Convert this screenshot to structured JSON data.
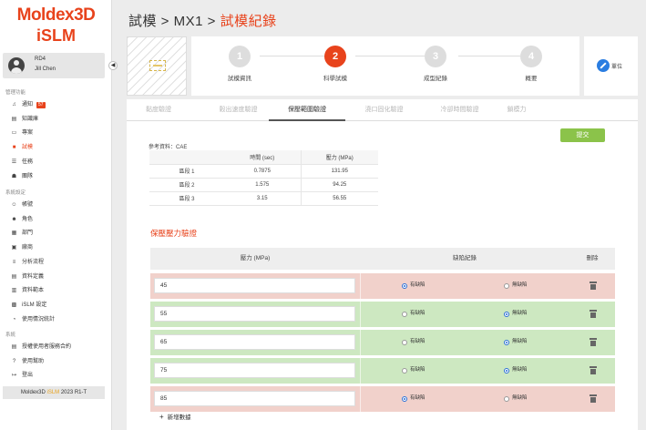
{
  "brand": {
    "line1": "Moldex3D",
    "line2": "iSLM"
  },
  "user": {
    "org": "RD4",
    "name": "Jill Chen"
  },
  "sidebar": {
    "section_manage": "管理功能",
    "manage_items": [
      {
        "label": "通知",
        "icon": "bell-icon",
        "badge": "57"
      },
      {
        "label": "知識庫",
        "icon": "book-icon"
      },
      {
        "label": "專案",
        "icon": "folder-icon"
      },
      {
        "label": "試模",
        "icon": "trial-icon"
      },
      {
        "label": "任務",
        "icon": "task-icon"
      },
      {
        "label": "團隊",
        "icon": "team-icon"
      }
    ],
    "section_system_settings": "系統設定",
    "settings_items": [
      {
        "label": "帳號",
        "icon": "account-icon"
      },
      {
        "label": "角色",
        "icon": "role-icon"
      },
      {
        "label": "部門",
        "icon": "department-icon"
      },
      {
        "label": "廠商",
        "icon": "vendor-icon"
      },
      {
        "label": "分析流程",
        "icon": "analysis-flow-icon"
      },
      {
        "label": "資料定義",
        "icon": "data-definition-icon"
      },
      {
        "label": "資料範本",
        "icon": "data-template-icon"
      },
      {
        "label": "iSLM 設定",
        "icon": "settings-icon"
      },
      {
        "label": "使用情況統計",
        "icon": "usage-stats-icon"
      }
    ],
    "section_system": "系統",
    "system_items": [
      {
        "label": "授權使用者服務合約",
        "icon": "license-icon"
      },
      {
        "label": "使用幫助",
        "icon": "help-icon"
      },
      {
        "label": "登出",
        "icon": "logout-icon"
      }
    ],
    "version_prefix": "Moldex3D ",
    "version_accent": "iSLM",
    "version_suffix": " 2023 R1-T"
  },
  "header": {
    "crumb1": "試模",
    "sep1": " > ",
    "crumb2": "MX1",
    "sep2": " > ",
    "current": "試模紀錄"
  },
  "steps": [
    {
      "num": "1",
      "label": "試模資訊"
    },
    {
      "num": "2",
      "label": "科學試模"
    },
    {
      "num": "3",
      "label": "成型紀錄"
    },
    {
      "num": "4",
      "label": "概要"
    }
  ],
  "settings_label": "單位",
  "tabs": [
    "黏度驗證",
    "穀出速度驗證",
    "保壓範圍驗證",
    "澆口固化驗證",
    "冷卻時間驗證",
    "鎖模力"
  ],
  "submit_label": "提交",
  "reference": {
    "label": "參考資料：CAE",
    "headers": [
      "",
      "時間 (sec)",
      "壓力 (MPa)"
    ],
    "rows": [
      [
        "區段 1",
        "0.7875",
        "131.95"
      ],
      [
        "區段 2",
        "1.575",
        "94.25"
      ],
      [
        "區段 3",
        "3.15",
        "56.55"
      ]
    ]
  },
  "pressure_section": {
    "title": "保壓壓力驗證",
    "col_pressure": "壓力 (MPa)",
    "col_defect": "缺陷紀錄",
    "col_delete": "刪除",
    "opt_defect": "有缺陷",
    "opt_no_defect": "無缺陷",
    "rows": [
      {
        "value": "45",
        "defect": true
      },
      {
        "value": "55",
        "defect": false
      },
      {
        "value": "65",
        "defect": false
      },
      {
        "value": "75",
        "defect": false
      },
      {
        "value": "85",
        "defect": true
      }
    ],
    "add_label": "新增數據"
  }
}
